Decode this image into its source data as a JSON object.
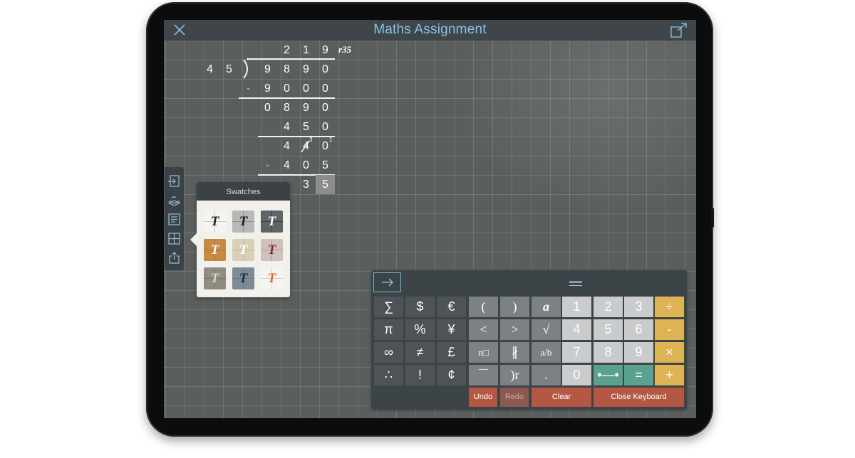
{
  "app": {
    "title": "Maths Assignment",
    "icons": {
      "close": "close-icon",
      "share": "share-icon"
    }
  },
  "division": {
    "quotient": [
      "2",
      "1",
      "9"
    ],
    "remainder_label": "r35",
    "divisor": [
      "4",
      "5"
    ],
    "dividend": [
      "9",
      "8",
      "9",
      "0"
    ],
    "minus_sign": "-",
    "steps": [
      {
        "minus": true,
        "digits": [
          "9",
          "0",
          "0",
          "0"
        ]
      },
      {
        "minus": false,
        "digits": [
          "0",
          "8",
          "9",
          "0"
        ]
      },
      {
        "minus": false,
        "digits": [
          "4",
          "5",
          "0"
        ]
      },
      {
        "minus": false,
        "digits": [
          "4",
          "4",
          "0"
        ],
        "borrow": [
          "3",
          "1"
        ]
      },
      {
        "minus": true,
        "digits": [
          "4",
          "0",
          "5"
        ]
      },
      {
        "minus": false,
        "digits": [
          "3",
          "5"
        ]
      }
    ]
  },
  "toolbar": {
    "items": [
      "import-icon",
      "layers-icon",
      "notes-icon",
      "grid-icon",
      "export-icon"
    ]
  },
  "swatches": {
    "title": "Swatches",
    "glyph": "T",
    "items": [
      {
        "bg": "#f4f4f2",
        "line": "#c9c9c9",
        "text": "#222222"
      },
      {
        "bg": "#b7b8b8",
        "line": "#8f9090",
        "text": "#1e1e1e"
      },
      {
        "bg": "#5f6567",
        "line": "#3b4043",
        "text": "#ffffff"
      },
      {
        "bg": "#c68a42",
        "line": "#a87233",
        "text": "#ffffff"
      },
      {
        "bg": "#d9cfb5",
        "line": "#c2b796",
        "text": "#ffffff"
      },
      {
        "bg": "#cfc2bd",
        "line": "#a99a95",
        "text": "#8e2232"
      },
      {
        "bg": "#8f8c82",
        "line": "#777469",
        "text": "#d9d6cc"
      },
      {
        "bg": "#7d8a97",
        "line": "#6a7784",
        "text": "#1d2a36"
      },
      {
        "bg": "#f4f4f2",
        "line": "#cfcfcf",
        "text": "#e06b2a"
      }
    ]
  },
  "keyboard": {
    "rows": [
      [
        "∑",
        "$",
        "€",
        "(",
        ")",
        "a",
        "1",
        "2",
        "3",
        "÷"
      ],
      [
        "π",
        "%",
        "¥",
        "<",
        ">",
        "√",
        "4",
        "5",
        "6",
        "-"
      ],
      [
        "∞",
        "≠",
        "£",
        "n□",
        "∦",
        "a/b",
        "7",
        "8",
        "9",
        "×"
      ],
      [
        "∴",
        "!",
        "¢",
        "‾‾",
        ")r",
        ".",
        "0",
        "•—•",
        "=",
        "+"
      ]
    ],
    "undo": "Undo",
    "redo": "Redo",
    "clear": "Clear",
    "close": "Close Keyboard",
    "arrow": "→",
    "colors": {
      "gold": "#ddb354",
      "teal": "#5aa18f",
      "red": "#b45844"
    }
  }
}
